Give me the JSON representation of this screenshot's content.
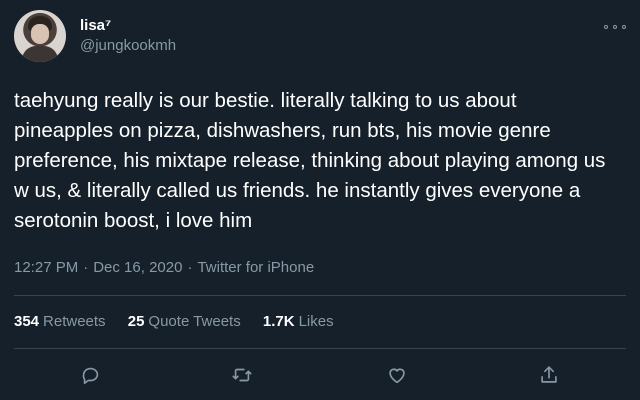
{
  "user": {
    "display_name": "lisa⁷",
    "handle": "@jungkookmh",
    "avatar_icon": "profile-photo"
  },
  "tweet": {
    "text": "taehyung really is our bestie. literally talking to us about pineapples on pizza, dishwashers, run bts, his movie genre preference, his mixtape release, thinking about playing among us w us, & literally called us friends. he instantly gives everyone a serotonin boost, i love him",
    "time": "12:27 PM",
    "date": "Dec 16, 2020",
    "source": "Twitter for iPhone",
    "separator": "·"
  },
  "stats": {
    "retweets": {
      "value": "354",
      "label": "Retweets"
    },
    "quote_tweets": {
      "value": "25",
      "label": "Quote Tweets"
    },
    "likes": {
      "value": "1.7K",
      "label": "Likes"
    }
  },
  "actions": [
    {
      "name": "reply-icon"
    },
    {
      "name": "retweet-icon"
    },
    {
      "name": "like-icon"
    },
    {
      "name": "share-icon"
    }
  ],
  "colors": {
    "background": "#15202b",
    "primary_text": "#ffffff",
    "secondary_text": "#8899a6",
    "divider": "#38444d"
  }
}
